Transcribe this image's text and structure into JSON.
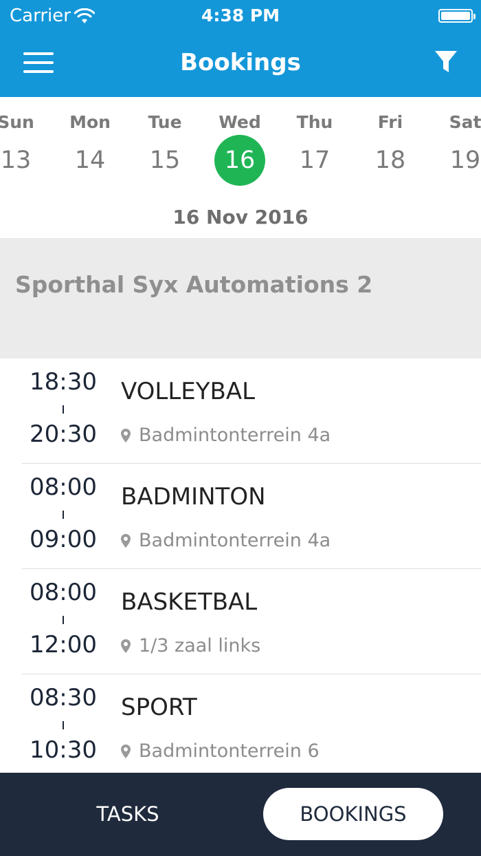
{
  "status": {
    "carrier": "Carrier",
    "time": "4:38 PM"
  },
  "header": {
    "title": "Bookings"
  },
  "week": {
    "days": [
      {
        "name": "Sun",
        "num": "13"
      },
      {
        "name": "Mon",
        "num": "14"
      },
      {
        "name": "Tue",
        "num": "15"
      },
      {
        "name": "Wed",
        "num": "16"
      },
      {
        "name": "Thu",
        "num": "17"
      },
      {
        "name": "Fri",
        "num": "18"
      },
      {
        "name": "Sat",
        "num": "19"
      }
    ],
    "selected_index": 3,
    "selected_date": "16 Nov 2016"
  },
  "section": {
    "title": "Sporthal Syx Automations 2"
  },
  "bookings": [
    {
      "start": "18:30",
      "end": "20:30",
      "activity": "VOLLEYBAL",
      "location": "Badmintonterrein 4a"
    },
    {
      "start": "08:00",
      "end": "09:00",
      "activity": "BADMINTON",
      "location": "Badmintonterrein 4a"
    },
    {
      "start": "08:00",
      "end": "12:00",
      "activity": "BASKETBAL",
      "location": "1/3 zaal links"
    },
    {
      "start": "08:30",
      "end": "10:30",
      "activity": "SPORT",
      "location": "Badmintonterrein 6"
    }
  ],
  "tabs": {
    "tasks": "TASKS",
    "bookings": "BOOKINGS"
  },
  "colors": {
    "primary": "#1497d9",
    "selected_day": "#1fb555",
    "tabbar": "#1f2a3d"
  },
  "icons": {
    "menu": "hamburger-menu-icon",
    "filter": "filter-icon",
    "location": "map-pin-icon"
  }
}
